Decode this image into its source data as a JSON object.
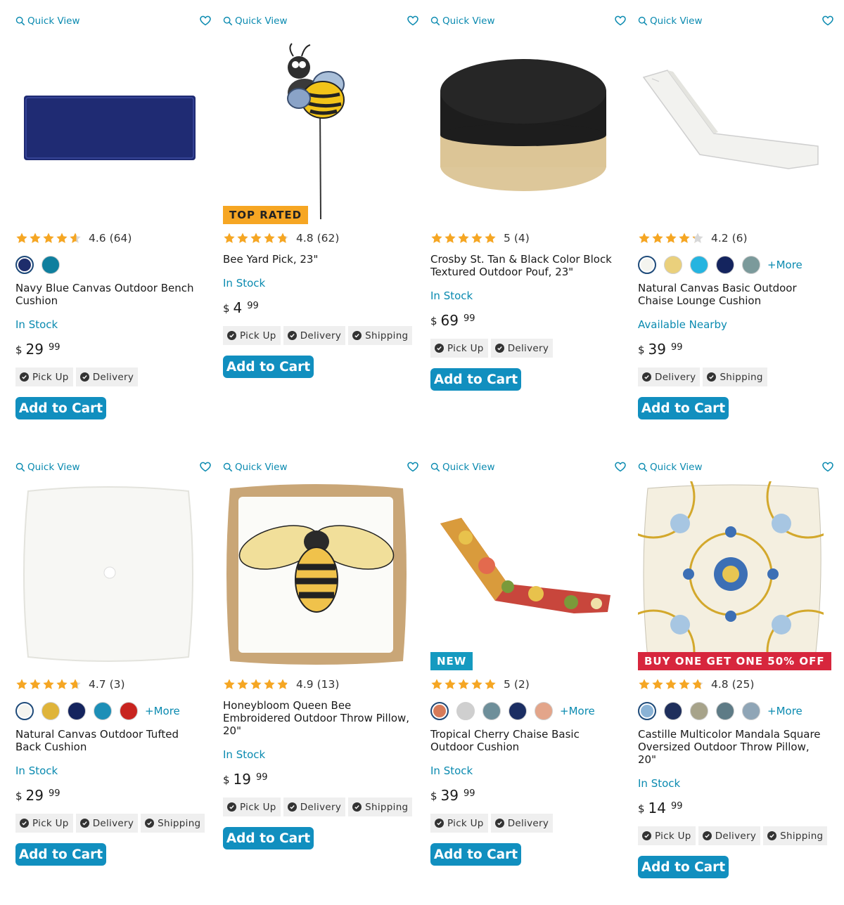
{
  "labels": {
    "quick_view": "Quick View",
    "add_to_cart": "Add to Cart",
    "currency": "$",
    "more": "+More"
  },
  "colors": {
    "accent": "#0a8ab0",
    "button": "#118fbf",
    "star": "#f5a623",
    "top_rated_bg": "#f6a623",
    "new_bg": "#159ac0",
    "promo_bg": "#d7263d"
  },
  "products": [
    {
      "name": "Navy Blue Canvas Outdoor Bench Cushion",
      "rating": "4.6",
      "reviews": "(64)",
      "stock": "In Stock",
      "dollars": "29",
      "cents": "99",
      "badge": "",
      "swatches": [
        "#1e2d6b",
        "#0f7f9e"
      ],
      "more": false,
      "fulfillment": [
        "Pick Up",
        "Delivery"
      ]
    },
    {
      "name": "Bee Yard Pick, 23\"",
      "rating": "4.8",
      "reviews": "(62)",
      "stock": "In Stock",
      "dollars": "4",
      "cents": "99",
      "badge": "TOP RATED",
      "swatches": [],
      "more": false,
      "fulfillment": [
        "Pick Up",
        "Delivery",
        "Shipping"
      ]
    },
    {
      "name": "Crosby St. Tan & Black Color Block Textured Outdoor Pouf, 23\"",
      "rating": "5",
      "reviews": "(4)",
      "stock": "In Stock",
      "dollars": "69",
      "cents": "99",
      "badge": "",
      "swatches": [],
      "more": false,
      "fulfillment": [
        "Pick Up",
        "Delivery"
      ]
    },
    {
      "name": "Natural Canvas Basic Outdoor Chaise Lounge Cushion",
      "rating": "4.2",
      "reviews": "(6)",
      "stock": "Available Nearby",
      "dollars": "39",
      "cents": "99",
      "badge": "",
      "swatches": [
        "#f4f4ef",
        "#ead07c",
        "#25b4e0",
        "#14245e",
        "#7b9a9b"
      ],
      "more": true,
      "fulfillment": [
        "Delivery",
        "Shipping"
      ]
    },
    {
      "name": "Natural Canvas Outdoor Tufted Back Cushion",
      "rating": "4.7",
      "reviews": "(3)",
      "stock": "In Stock",
      "dollars": "29",
      "cents": "99",
      "badge": "",
      "swatches": [
        "#f4f4ef",
        "#dfb43a",
        "#14245e",
        "#1d8fb7",
        "#c8241f"
      ],
      "more": true,
      "fulfillment": [
        "Pick Up",
        "Delivery",
        "Shipping"
      ]
    },
    {
      "name": "Honeybloom Queen Bee Embroidered Outdoor Throw Pillow, 20\"",
      "rating": "4.9",
      "reviews": "(13)",
      "stock": "In Stock",
      "dollars": "19",
      "cents": "99",
      "badge": "",
      "swatches": [],
      "more": false,
      "fulfillment": [
        "Pick Up",
        "Delivery",
        "Shipping"
      ]
    },
    {
      "name": "Tropical Cherry Chaise Basic Outdoor Cushion",
      "rating": "5",
      "reviews": "(2)",
      "stock": "In Stock",
      "dollars": "39",
      "cents": "99",
      "badge": "NEW",
      "swatches": [
        "#d77b5a",
        "#cfcfcf",
        "#6e8f9a",
        "#1b2e63",
        "#e3a58a"
      ],
      "more": true,
      "fulfillment": [
        "Pick Up",
        "Delivery"
      ]
    },
    {
      "name": "Castille Multicolor Mandala Square Oversized Outdoor Throw Pillow, 20\"",
      "rating": "4.8",
      "reviews": "(25)",
      "stock": "In Stock",
      "dollars": "14",
      "cents": "99",
      "badge": "BUY ONE GET ONE 50% OFF",
      "swatches": [
        "#8ab3d6",
        "#1f2f5c",
        "#a7a38a",
        "#5e7b86",
        "#8fa5b6"
      ],
      "more": true,
      "fulfillment": [
        "Pick Up",
        "Delivery",
        "Shipping"
      ]
    }
  ]
}
